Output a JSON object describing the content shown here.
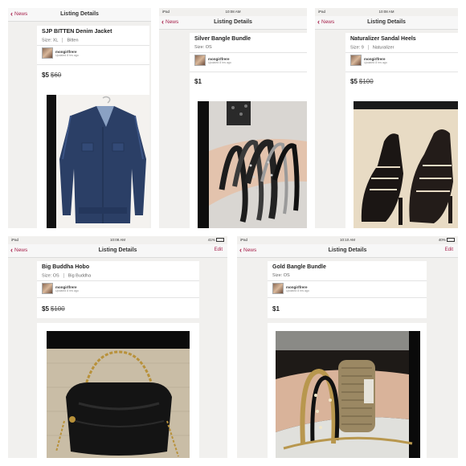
{
  "panels": [
    {
      "status": {
        "left": "",
        "time": "",
        "right": ""
      },
      "nav": {
        "back": "News",
        "title": "Listing Details",
        "edit": ""
      },
      "listing": {
        "title": "SJP BITTEN Denim Jacket",
        "size": "Size: XL",
        "brand": "Bitten",
        "seller": "mongirlfrere",
        "updated": "Updated 8 hrs ago",
        "price": "$5",
        "original_price": "$60"
      },
      "photo_subject": "denim jacket on hanger"
    },
    {
      "status": {
        "left": "iPad",
        "time": "10:08 AM",
        "right": ""
      },
      "nav": {
        "back": "News",
        "title": "Listing Details",
        "edit": ""
      },
      "listing": {
        "title": "Silver Bangle Bundle",
        "size": "Size: OS",
        "brand": "",
        "seller": "mongirlfrere",
        "updated": "Updated 8 hrs ago",
        "price": "$1",
        "original_price": ""
      },
      "photo_subject": "bangles on wrist"
    },
    {
      "status": {
        "left": "iPad",
        "time": "10:08 AM",
        "right": ""
      },
      "nav": {
        "back": "News",
        "title": "Listing Details",
        "edit": ""
      },
      "listing": {
        "title": "Naturalizer Sandal Heels",
        "size": "Size: 9",
        "brand": "Naturalizer",
        "seller": "mongirlfrere",
        "updated": "Updated 8 hrs ago",
        "price": "$5",
        "original_price": "$100"
      },
      "photo_subject": "black strappy heels"
    },
    {
      "status": {
        "left": "iPad",
        "time": "10:08 AM",
        "right": "41%"
      },
      "nav": {
        "back": "News",
        "title": "Listing Details",
        "edit": "Edit"
      },
      "listing": {
        "title": "Big Buddha Hobo",
        "size": "Size: OS",
        "brand": "Big Buddha",
        "seller": "mongirlfrere",
        "updated": "Updated 8 hrs ago",
        "price": "$5",
        "original_price": "$100"
      },
      "photo_subject": "black hobo bag with chain strap"
    },
    {
      "status": {
        "left": "iPad",
        "time": "10:10 AM",
        "right": "40%"
      },
      "nav": {
        "back": "News",
        "title": "Listing Details",
        "edit": "Edit"
      },
      "listing": {
        "title": "Gold Bangle Bundle",
        "size": "Size: OS",
        "brand": "",
        "seller": "mongirlfrere",
        "updated": "Updated 8 hrs ago",
        "price": "$1",
        "original_price": ""
      },
      "photo_subject": "gold bangles on wrist"
    }
  ]
}
